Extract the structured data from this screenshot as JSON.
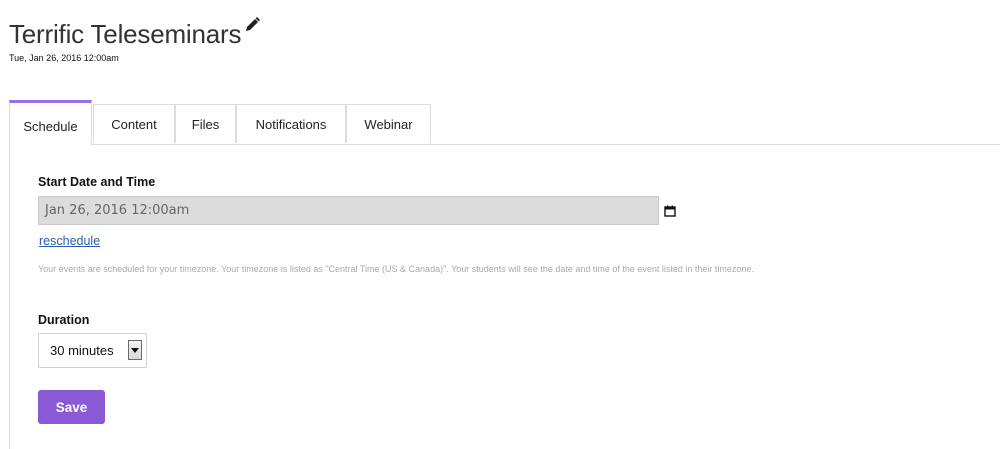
{
  "page": {
    "title": "Terrific Teleseminars",
    "subtitle": "Tue, Jan 26, 2016 12:00am"
  },
  "tabs": [
    {
      "label": "Schedule",
      "active": true
    },
    {
      "label": "Content",
      "active": false
    },
    {
      "label": "Files",
      "active": false
    },
    {
      "label": "Notifications",
      "active": false
    },
    {
      "label": "Webinar",
      "active": false
    }
  ],
  "schedule": {
    "start_label": "Start Date and Time",
    "start_value": "Jan 26, 2016 12:00am",
    "reschedule_link": "reschedule",
    "help_text": "Your events are scheduled for your timezone. Your timezone is listed as \"Central Time (US & Canada)\". Your students will see the date and time of the event listed in their timezone.",
    "duration_label": "Duration",
    "duration_value": "30 minutes",
    "save_label": "Save"
  },
  "colors": {
    "accent": "#8a5ad6",
    "tab_accent": "#9b6fe0",
    "link": "#2a5db0",
    "input_bg": "#dcdcdc"
  },
  "icons": {
    "edit": "pencil-icon",
    "calendar": "calendar-icon",
    "select_arrow": "chevron-down-icon"
  }
}
